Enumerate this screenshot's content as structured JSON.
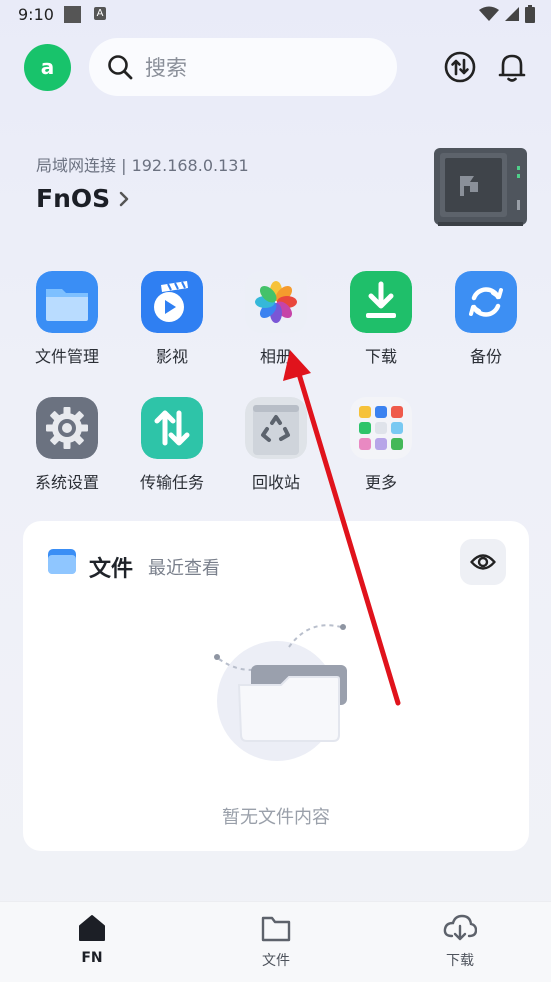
{
  "status": {
    "time": "9:10",
    "a_badge": "A"
  },
  "header": {
    "avatar_letter": "a",
    "search_placeholder": "搜索"
  },
  "device": {
    "connection": "局域网连接 | 192.168.0.131",
    "name": "FnOS"
  },
  "apps": [
    {
      "label": "文件管理",
      "icon": "folder-icon"
    },
    {
      "label": "影视",
      "icon": "video-icon"
    },
    {
      "label": "相册",
      "icon": "photos-icon"
    },
    {
      "label": "下载",
      "icon": "download-icon"
    },
    {
      "label": "备份",
      "icon": "backup-icon"
    },
    {
      "label": "系统设置",
      "icon": "settings-icon"
    },
    {
      "label": "传输任务",
      "icon": "transfer-icon"
    },
    {
      "label": "回收站",
      "icon": "recycle-bin-icon"
    },
    {
      "label": "更多",
      "icon": "more-apps-icon"
    }
  ],
  "files_card": {
    "title": "文件",
    "subtitle": "最近查看",
    "empty_text": "暂无文件内容"
  },
  "bottom_nav": [
    {
      "label": "FN",
      "icon": "home-icon",
      "active": true
    },
    {
      "label": "文件",
      "icon": "folder-outline-icon",
      "active": false
    },
    {
      "label": "下载",
      "icon": "cloud-download-icon",
      "active": false
    }
  ],
  "colors": {
    "accent_green": "#18c36b",
    "arrow_red": "#e0131c"
  }
}
